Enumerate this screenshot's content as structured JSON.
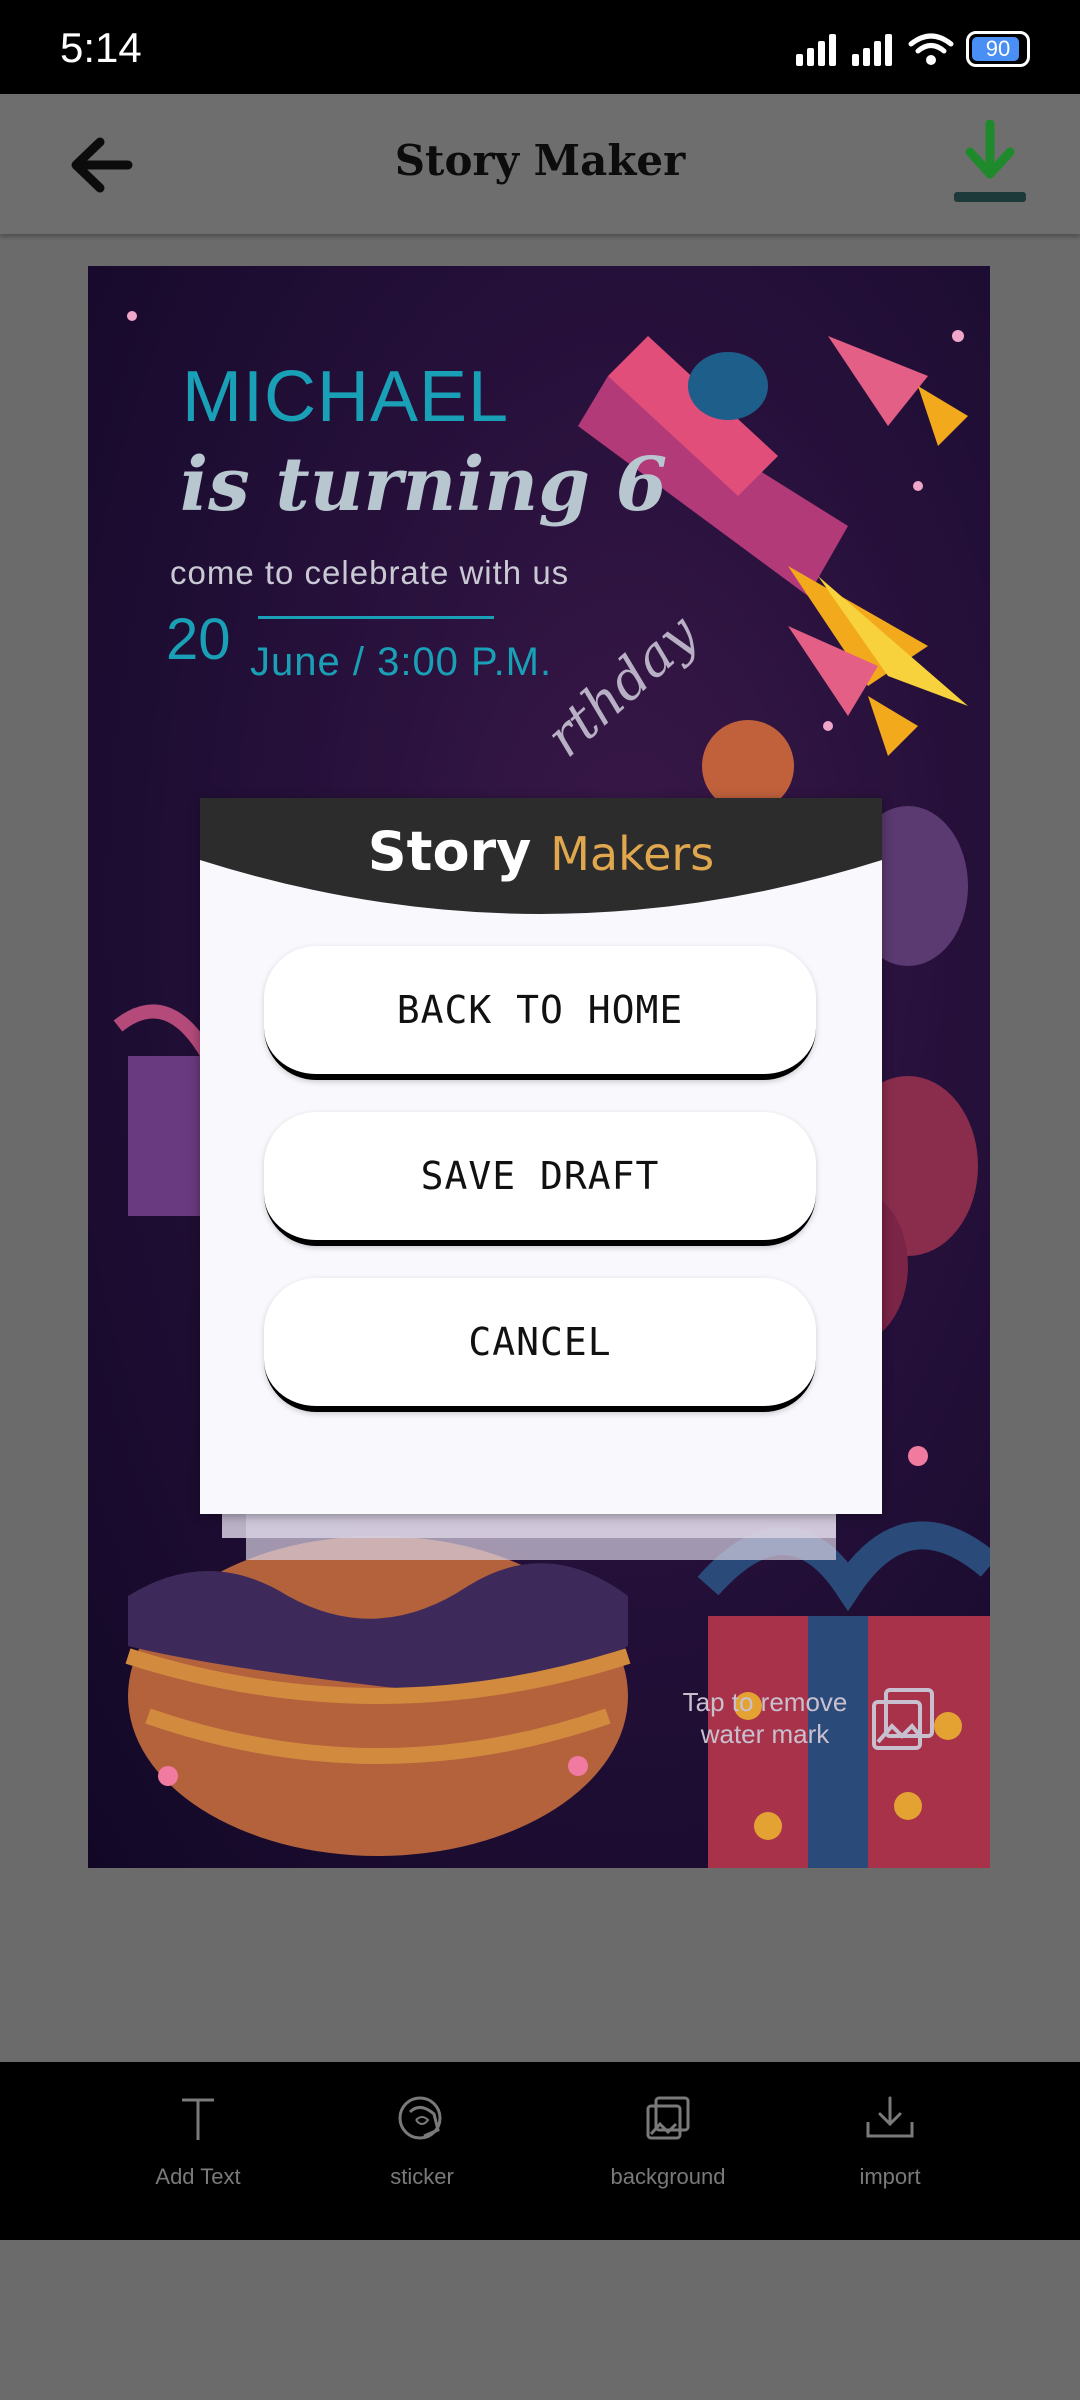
{
  "status_bar": {
    "time": "5:14",
    "battery": "90",
    "battery_level": 0.9
  },
  "app_bar": {
    "title": "Story Maker",
    "back_icon": "arrow-left-icon",
    "download_icon": "download-icon",
    "download_color": "#1f8a2c"
  },
  "poster": {
    "name": "MICHAEL",
    "turning": "is turning 6",
    "celebrate": "come to celebrate with us",
    "day": "20",
    "date": "June / 3:00 P.M.",
    "birthday_fragment": "rthday",
    "watermark": "Tap to remove water mark",
    "accent_color": "#1aa0b6"
  },
  "dialog": {
    "logo_primary": "Story",
    "logo_secondary": "Makers",
    "buttons": {
      "home": "BACK TO HOME",
      "draft": "SAVE DRAFT",
      "cancel": "CANCEL"
    }
  },
  "toolbar": {
    "items": [
      {
        "label": "Add Text",
        "icon": "text-icon"
      },
      {
        "label": "sticker",
        "icon": "sticker-icon"
      },
      {
        "label": "background",
        "icon": "background-icon"
      },
      {
        "label": "import",
        "icon": "import-icon"
      }
    ]
  }
}
